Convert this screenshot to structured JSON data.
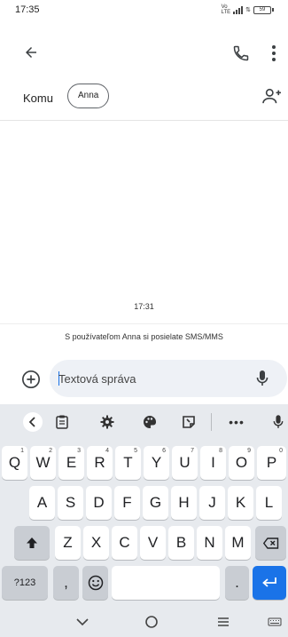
{
  "status_bar": {
    "time": "17:35",
    "volte_top": "Vo",
    "volte_bottom": "LTE",
    "battery": "59"
  },
  "app_bar": {
    "back_icon": "arrow-back-icon",
    "call_icon": "phone-icon",
    "more_icon": "more-vert-icon"
  },
  "recipients": {
    "to_label": "Komu",
    "chips": [
      "Anna"
    ],
    "add_icon": "add-person-icon"
  },
  "thread": {
    "timestamp": "17:31",
    "note": "S používateľom Anna si posielate SMS/MMS"
  },
  "compose": {
    "placeholder": "Textová správa",
    "attach_icon": "add-circle-icon",
    "mic_icon": "mic-icon"
  },
  "keyboard": {
    "toolbar_icons": [
      "chevron-left-icon",
      "clipboard-icon",
      "gear-icon",
      "palette-icon",
      "sticker-icon",
      "more-icon",
      "mic-icon"
    ],
    "row1": [
      {
        "label": "Q",
        "hint": "1"
      },
      {
        "label": "W",
        "hint": "2"
      },
      {
        "label": "E",
        "hint": "3"
      },
      {
        "label": "R",
        "hint": "4"
      },
      {
        "label": "T",
        "hint": "5"
      },
      {
        "label": "Y",
        "hint": "6"
      },
      {
        "label": "U",
        "hint": "7"
      },
      {
        "label": "I",
        "hint": "8"
      },
      {
        "label": "O",
        "hint": "9"
      },
      {
        "label": "P",
        "hint": "0"
      }
    ],
    "row2": [
      "A",
      "S",
      "D",
      "F",
      "G",
      "H",
      "J",
      "K",
      "L"
    ],
    "row3": [
      "Z",
      "X",
      "C",
      "V",
      "B",
      "N",
      "M"
    ],
    "symbols_label": "?123",
    "comma": ",",
    "period": "."
  },
  "nav_bar": {
    "icons": [
      "chevron-down-icon",
      "home-circle-icon",
      "menu-icon",
      "keyboard-switch-icon"
    ]
  }
}
